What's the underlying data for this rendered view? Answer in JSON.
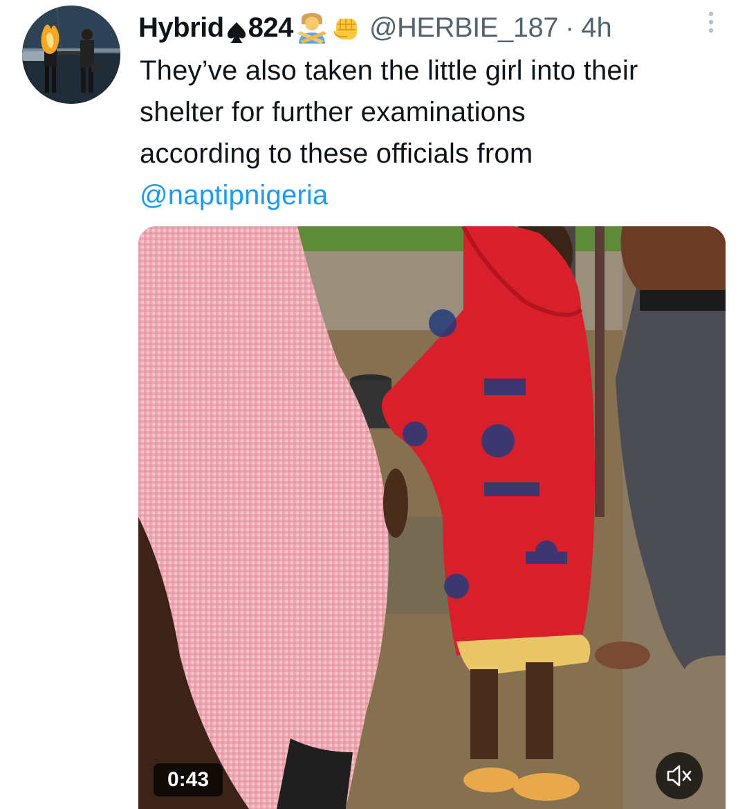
{
  "tweet": {
    "display_name": "Hybrid",
    "display_name_suffix": "824",
    "name_icons": [
      "spade-icon",
      "person-crossing-arms-emoji-icon",
      "raised-fist-emoji-icon"
    ],
    "handle": "@HERBIE_187",
    "separator": "·",
    "timestamp": "4h",
    "text_lines": [
      "They’ve also taken the little girl into their",
      "shelter for further examinations",
      "according to these officials from"
    ],
    "mention": "@naptipnigeria",
    "colors": {
      "text": "#0f1419",
      "secondary": "#536471",
      "link": "#1d9bf0"
    }
  },
  "video": {
    "duration": "0:43",
    "volume_state": "muted",
    "volume_icon": "speaker-muted-icon"
  }
}
